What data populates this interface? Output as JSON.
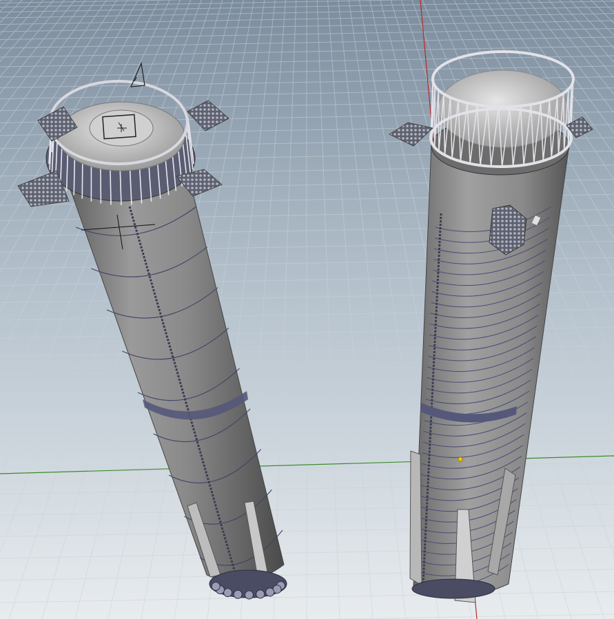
{
  "viewport": {
    "background_top": "#7e8fa0",
    "background_bottom": "#e6ebee",
    "grid_color": "#c7d1da",
    "axis_x_color": "#3c8c2a",
    "axis_y_color": "#b42a2a"
  },
  "models": [
    {
      "id": "booster-left",
      "body_color": "#8a8a8a",
      "rim": "railing-ring",
      "platforms": 3
    },
    {
      "id": "booster-right",
      "body_color": "#8c8c8c",
      "rim": "truss-ring",
      "platforms": 2,
      "hatch": true
    }
  ],
  "markers": [
    {
      "id": "marker-yellow",
      "color": "#f1c40f"
    }
  ]
}
